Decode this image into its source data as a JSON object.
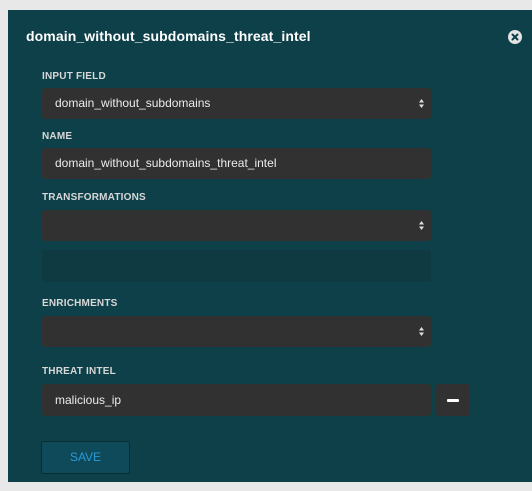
{
  "panel": {
    "title": "domain_without_subdomains_threat_intel",
    "close_icon": "close-icon"
  },
  "input_field": {
    "label": "INPUT FIELD",
    "value": "domain_without_subdomains"
  },
  "name": {
    "label": "NAME",
    "value": "domain_without_subdomains_threat_intel"
  },
  "transformations": {
    "label": "TRANSFORMATIONS",
    "value": ""
  },
  "enrichments": {
    "label": "ENRICHMENTS",
    "value": ""
  },
  "threat_intel": {
    "label": "THREAT INTEL",
    "value": "malicious_ip",
    "remove_icon": "minus-icon"
  },
  "actions": {
    "save_label": "SAVE"
  },
  "colors": {
    "panel_bg": "#0d4049",
    "field_bg": "#313131",
    "save_text": "#2a9ad6"
  }
}
